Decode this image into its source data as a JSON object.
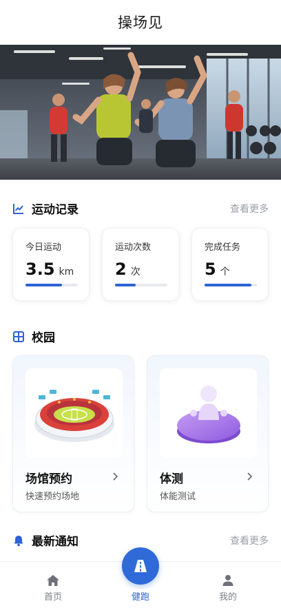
{
  "header": {
    "title": "操场见"
  },
  "hero": {
    "image": "fitness-class-photo"
  },
  "records": {
    "title": "运动记录",
    "more": "查看更多",
    "icon": "line-chart-icon",
    "stats": [
      {
        "title": "今日运动",
        "value": "3.5",
        "unit": "km",
        "progress": 0.7
      },
      {
        "title": "运动次数",
        "value": "2",
        "unit": "次",
        "progress": 0.4
      },
      {
        "title": "完成任务",
        "value": "5",
        "unit": "个",
        "progress": 0.9
      }
    ]
  },
  "campus": {
    "title": "校园",
    "icon": "grid-icon",
    "cards": [
      {
        "title": "场馆预约",
        "subtitle": "快速预约场地",
        "icon": "stadium-icon"
      },
      {
        "title": "体测",
        "subtitle": "体能测试",
        "icon": "fitness-test-icon"
      }
    ]
  },
  "notices": {
    "title": "最新通知",
    "more": "查看更多",
    "icon": "bell-icon"
  },
  "tabbar": {
    "items": [
      {
        "label": "首页",
        "icon": "home-icon",
        "active": false
      },
      {
        "label": "健跑",
        "icon": "road-icon",
        "active": true
      },
      {
        "label": "我的",
        "icon": "user-icon",
        "active": false
      }
    ]
  },
  "colors": {
    "accent": "#2d63d4",
    "muted": "#9aa0a8",
    "text": "#111111"
  }
}
